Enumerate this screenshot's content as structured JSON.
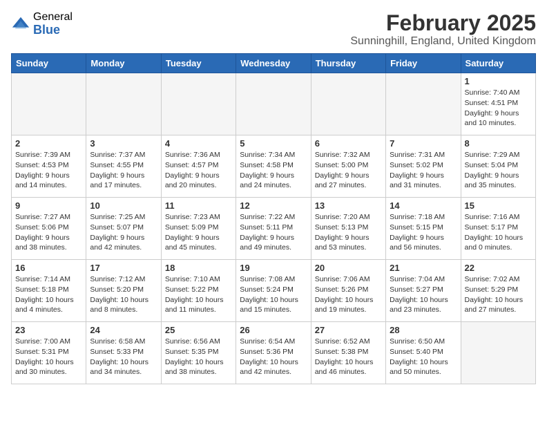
{
  "logo": {
    "general": "General",
    "blue": "Blue"
  },
  "title": "February 2025",
  "subtitle": "Sunninghill, England, United Kingdom",
  "weekdays": [
    "Sunday",
    "Monday",
    "Tuesday",
    "Wednesday",
    "Thursday",
    "Friday",
    "Saturday"
  ],
  "weeks": [
    [
      {
        "day": "",
        "info": ""
      },
      {
        "day": "",
        "info": ""
      },
      {
        "day": "",
        "info": ""
      },
      {
        "day": "",
        "info": ""
      },
      {
        "day": "",
        "info": ""
      },
      {
        "day": "",
        "info": ""
      },
      {
        "day": "1",
        "info": "Sunrise: 7:40 AM\nSunset: 4:51 PM\nDaylight: 9 hours and 10 minutes."
      }
    ],
    [
      {
        "day": "2",
        "info": "Sunrise: 7:39 AM\nSunset: 4:53 PM\nDaylight: 9 hours and 14 minutes."
      },
      {
        "day": "3",
        "info": "Sunrise: 7:37 AM\nSunset: 4:55 PM\nDaylight: 9 hours and 17 minutes."
      },
      {
        "day": "4",
        "info": "Sunrise: 7:36 AM\nSunset: 4:57 PM\nDaylight: 9 hours and 20 minutes."
      },
      {
        "day": "5",
        "info": "Sunrise: 7:34 AM\nSunset: 4:58 PM\nDaylight: 9 hours and 24 minutes."
      },
      {
        "day": "6",
        "info": "Sunrise: 7:32 AM\nSunset: 5:00 PM\nDaylight: 9 hours and 27 minutes."
      },
      {
        "day": "7",
        "info": "Sunrise: 7:31 AM\nSunset: 5:02 PM\nDaylight: 9 hours and 31 minutes."
      },
      {
        "day": "8",
        "info": "Sunrise: 7:29 AM\nSunset: 5:04 PM\nDaylight: 9 hours and 35 minutes."
      }
    ],
    [
      {
        "day": "9",
        "info": "Sunrise: 7:27 AM\nSunset: 5:06 PM\nDaylight: 9 hours and 38 minutes."
      },
      {
        "day": "10",
        "info": "Sunrise: 7:25 AM\nSunset: 5:07 PM\nDaylight: 9 hours and 42 minutes."
      },
      {
        "day": "11",
        "info": "Sunrise: 7:23 AM\nSunset: 5:09 PM\nDaylight: 9 hours and 45 minutes."
      },
      {
        "day": "12",
        "info": "Sunrise: 7:22 AM\nSunset: 5:11 PM\nDaylight: 9 hours and 49 minutes."
      },
      {
        "day": "13",
        "info": "Sunrise: 7:20 AM\nSunset: 5:13 PM\nDaylight: 9 hours and 53 minutes."
      },
      {
        "day": "14",
        "info": "Sunrise: 7:18 AM\nSunset: 5:15 PM\nDaylight: 9 hours and 56 minutes."
      },
      {
        "day": "15",
        "info": "Sunrise: 7:16 AM\nSunset: 5:17 PM\nDaylight: 10 hours and 0 minutes."
      }
    ],
    [
      {
        "day": "16",
        "info": "Sunrise: 7:14 AM\nSunset: 5:18 PM\nDaylight: 10 hours and 4 minutes."
      },
      {
        "day": "17",
        "info": "Sunrise: 7:12 AM\nSunset: 5:20 PM\nDaylight: 10 hours and 8 minutes."
      },
      {
        "day": "18",
        "info": "Sunrise: 7:10 AM\nSunset: 5:22 PM\nDaylight: 10 hours and 11 minutes."
      },
      {
        "day": "19",
        "info": "Sunrise: 7:08 AM\nSunset: 5:24 PM\nDaylight: 10 hours and 15 minutes."
      },
      {
        "day": "20",
        "info": "Sunrise: 7:06 AM\nSunset: 5:26 PM\nDaylight: 10 hours and 19 minutes."
      },
      {
        "day": "21",
        "info": "Sunrise: 7:04 AM\nSunset: 5:27 PM\nDaylight: 10 hours and 23 minutes."
      },
      {
        "day": "22",
        "info": "Sunrise: 7:02 AM\nSunset: 5:29 PM\nDaylight: 10 hours and 27 minutes."
      }
    ],
    [
      {
        "day": "23",
        "info": "Sunrise: 7:00 AM\nSunset: 5:31 PM\nDaylight: 10 hours and 30 minutes."
      },
      {
        "day": "24",
        "info": "Sunrise: 6:58 AM\nSunset: 5:33 PM\nDaylight: 10 hours and 34 minutes."
      },
      {
        "day": "25",
        "info": "Sunrise: 6:56 AM\nSunset: 5:35 PM\nDaylight: 10 hours and 38 minutes."
      },
      {
        "day": "26",
        "info": "Sunrise: 6:54 AM\nSunset: 5:36 PM\nDaylight: 10 hours and 42 minutes."
      },
      {
        "day": "27",
        "info": "Sunrise: 6:52 AM\nSunset: 5:38 PM\nDaylight: 10 hours and 46 minutes."
      },
      {
        "day": "28",
        "info": "Sunrise: 6:50 AM\nSunset: 5:40 PM\nDaylight: 10 hours and 50 minutes."
      },
      {
        "day": "",
        "info": ""
      }
    ]
  ]
}
